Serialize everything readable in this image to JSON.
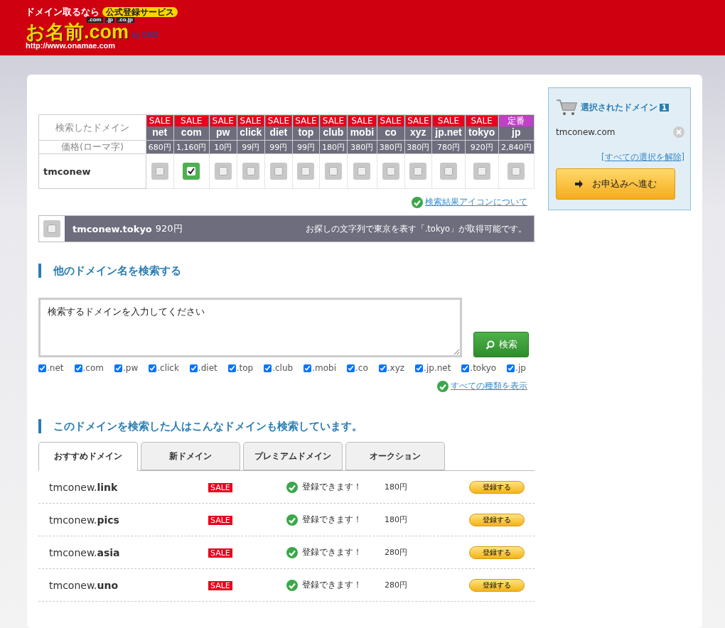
{
  "header": {
    "logo": {
      "tagline": "ドメイン取るなら",
      "badge": "公式登録サービス",
      "tlds": [
        ".com",
        ".jp",
        ".co.jp"
      ],
      "name": "お名前.com",
      "by": "by GMO",
      "url": "http://www.onamae.com"
    }
  },
  "results_table": {
    "head_label": "検索したドメイン",
    "price_label": "価格(ローマ字)",
    "columns": [
      {
        "tag": "SALE",
        "kind": "sale",
        "tld": "net",
        "price": "680円"
      },
      {
        "tag": "SALE",
        "kind": "sale",
        "tld": "com",
        "price": "1,160円"
      },
      {
        "tag": "SALE",
        "kind": "sale",
        "tld": "pw",
        "price": "10円"
      },
      {
        "tag": "SALE",
        "kind": "sale",
        "tld": "click",
        "price": "99円"
      },
      {
        "tag": "SALE",
        "kind": "sale",
        "tld": "diet",
        "price": "99円"
      },
      {
        "tag": "SALE",
        "kind": "sale",
        "tld": "top",
        "price": "99円"
      },
      {
        "tag": "SALE",
        "kind": "sale",
        "tld": "club",
        "price": "180円"
      },
      {
        "tag": "SALE",
        "kind": "sale",
        "tld": "mobi",
        "price": "380円"
      },
      {
        "tag": "SALE",
        "kind": "sale",
        "tld": "co",
        "price": "380円"
      },
      {
        "tag": "SALE",
        "kind": "sale",
        "tld": "xyz",
        "price": "380円"
      },
      {
        "tag": "SALE",
        "kind": "sale",
        "tld": "jp.net",
        "price": "780円"
      },
      {
        "tag": "SALE",
        "kind": "sale",
        "tld": "tokyo",
        "price": "920円"
      },
      {
        "tag": "定番",
        "kind": "standard",
        "tld": "jp",
        "price": "2,840円"
      }
    ],
    "rows": [
      {
        "name": "tmconew",
        "checked": [
          false,
          true,
          false,
          false,
          false,
          false,
          false,
          false,
          false,
          false,
          false,
          false,
          false
        ]
      }
    ],
    "icon_link": "検索結果アイコンについて"
  },
  "promo": {
    "checked": false,
    "domain": "tmconew.tokyo",
    "price": "920円",
    "note": "お探しの文字列で東京を表す「.tokyo」が取得可能です。"
  },
  "search": {
    "heading": "他のドメイン名を検索する",
    "placeholder": "検索するドメインを入力してください",
    "button": "検索",
    "tlds": [
      {
        "label": ".net",
        "checked": true
      },
      {
        "label": ".com",
        "checked": true
      },
      {
        "label": ".pw",
        "checked": true
      },
      {
        "label": ".click",
        "checked": true
      },
      {
        "label": ".diet",
        "checked": true
      },
      {
        "label": ".top",
        "checked": true
      },
      {
        "label": ".club",
        "checked": true
      },
      {
        "label": ".mobi",
        "checked": true
      },
      {
        "label": ".co",
        "checked": true
      },
      {
        "label": ".xyz",
        "checked": true
      },
      {
        "label": ".jp.net",
        "checked": true
      },
      {
        "label": ".tokyo",
        "checked": true
      },
      {
        "label": ".jp",
        "checked": true
      }
    ],
    "show_all": "すべての種類を表示"
  },
  "suggest": {
    "heading": "このドメインを検索した人はこんなドメインも検索しています。",
    "tabs": [
      {
        "label": "おすすめドメイン",
        "selected": true
      },
      {
        "label": "新ドメイン",
        "selected": false
      },
      {
        "label": "プレミアムドメイン",
        "selected": false
      },
      {
        "label": "オークション",
        "selected": false
      }
    ],
    "rows": [
      {
        "domain": "tmconew.**link**",
        "badge": "SALE",
        "status": "登録できます！",
        "price": "180円",
        "button": "登録する"
      },
      {
        "domain": "tmconew.**pics**",
        "badge": "SALE",
        "status": "登録できます！",
        "price": "180円",
        "button": "登録する"
      },
      {
        "domain": "tmconew.**asia**",
        "badge": "SALE",
        "status": "登録できます！",
        "price": "280円",
        "button": "登録する"
      },
      {
        "domain": "tmconew.**uno**",
        "badge": "SALE",
        "status": "登録できます！",
        "price": "280円",
        "button": "登録する"
      }
    ]
  },
  "cart": {
    "title": "選択されたドメイン",
    "count": "1",
    "items": [
      "tmconew.com"
    ],
    "clear": "[すべての選択を解除]",
    "proceed": "お申込みへ進む"
  }
}
